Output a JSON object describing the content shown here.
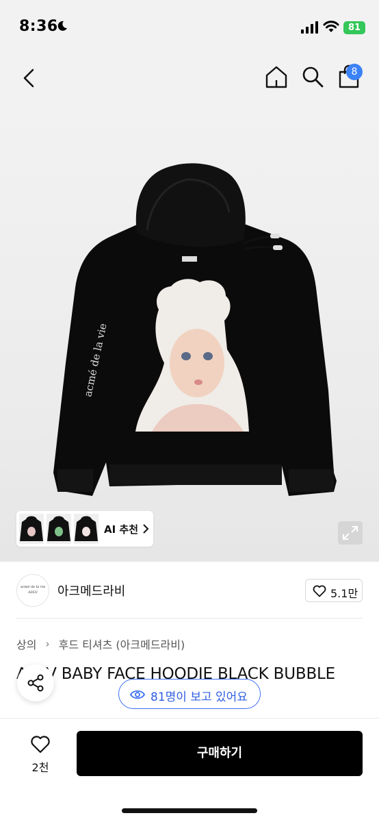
{
  "status_bar": {
    "time": "8:36",
    "battery": "81"
  },
  "nav": {
    "cart_count": "8"
  },
  "gallery": {
    "ai_label": "AI 추천",
    "garment_print": "acmé de la vie"
  },
  "brand": {
    "name": "아크메드라비",
    "logo_line1": "acmé de la vie",
    "logo_line2": "ADLV",
    "like_count": "5.1만"
  },
  "breadcrumb": {
    "items": [
      "상의",
      "후드 티셔츠 (아크메드라비)"
    ]
  },
  "product": {
    "title": "ADLV BABY FACE HOODIE BLACK BUBBLE",
    "viewers": "81명이 보고 있어요"
  },
  "bottom_bar": {
    "fav_count": "2천",
    "buy_label": "구매하기"
  },
  "colors": {
    "accent": "#3b6ef5",
    "badge": "#3b82f6",
    "battery": "#34c759",
    "buy_button": "#000000"
  }
}
